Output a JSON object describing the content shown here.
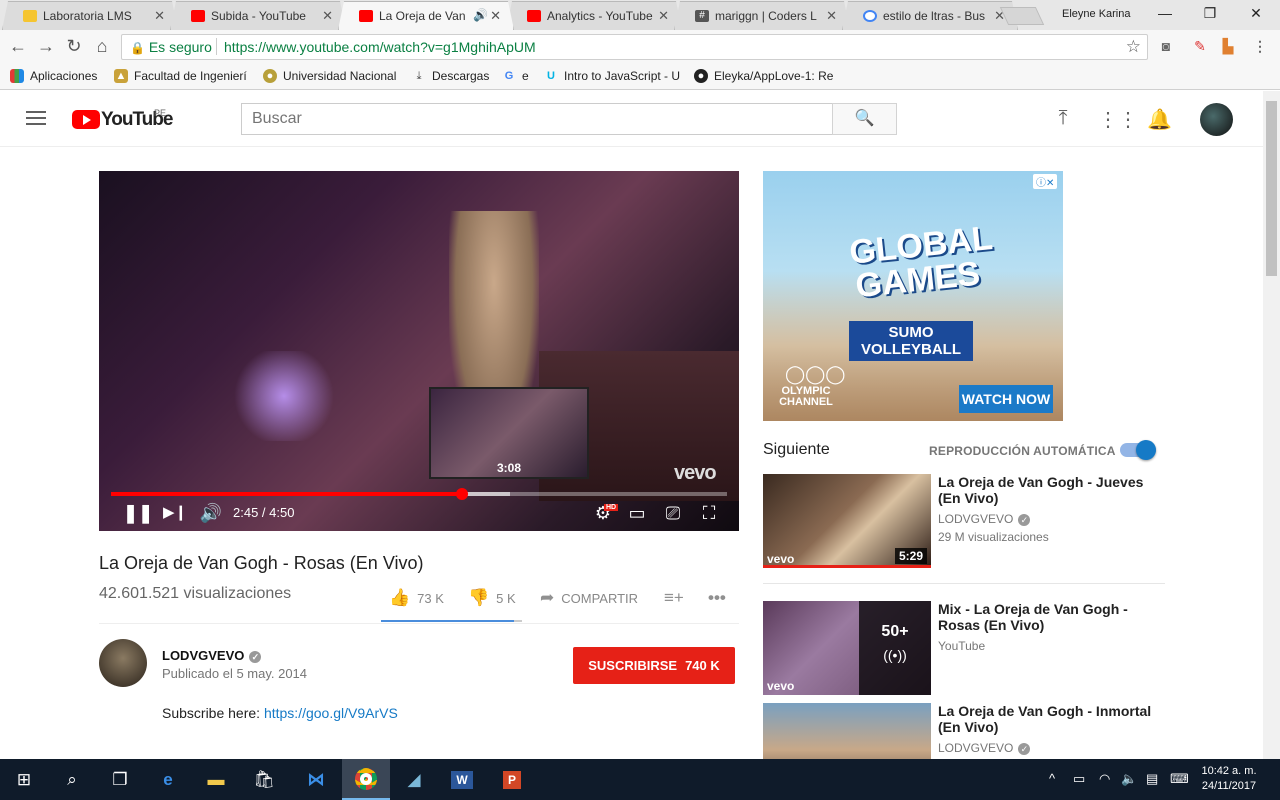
{
  "browser": {
    "tabs": [
      {
        "title": "Laboratoria LMS",
        "favicon_color": "#f5c531",
        "active": false
      },
      {
        "title": "Subida - YouTube",
        "favicon_color": "#ff0000",
        "active": false
      },
      {
        "title": "La Oreja de Van",
        "favicon_color": "#ff0000",
        "active": true,
        "audio": true
      },
      {
        "title": "Analytics - YouTube",
        "favicon_color": "#ff0000",
        "active": false
      },
      {
        "title": "mariggn | Coders L",
        "favicon_color": "#555555",
        "active": false
      },
      {
        "title": "estilo de ltras - Bus",
        "favicon_color": "#4285f4",
        "active": false
      }
    ],
    "user": "Eleyne Karina",
    "secure_label": "Es seguro",
    "url": "https://www.youtube.com/watch?v=g1MghihApUM",
    "bookmarks": [
      {
        "label": "Aplicaciones",
        "icon": "apps-grid-icon"
      },
      {
        "label": "Facultad de Ingenierí",
        "icon": "faculty-icon"
      },
      {
        "label": "Universidad Nacional",
        "icon": "university-icon"
      },
      {
        "label": "Descargas",
        "icon": "download-icon"
      },
      {
        "label": "e",
        "icon": "google-icon"
      },
      {
        "label": "Intro to JavaScript - U",
        "icon": "udacity-icon"
      },
      {
        "label": "Eleyka/AppLove-1: Re",
        "icon": "github-icon"
      }
    ]
  },
  "youtube": {
    "logo_text": "YouTube",
    "country": "PE",
    "search_placeholder": "Buscar"
  },
  "player": {
    "current_time": "2:45",
    "duration": "4:50",
    "time_display": "2:45 / 4:50",
    "preview_time": "3:08",
    "played_fraction": 0.569,
    "buffered_fraction": 0.647,
    "watermark": "vevo"
  },
  "video": {
    "title": "La Oreja de Van Gogh - Rosas (En Vivo)",
    "views": "42.601.521 visualizaciones",
    "likes": "73 K",
    "dislikes": "5 K",
    "share_label": "COMPARTIR",
    "like_fraction": 0.94,
    "channel": "LODVGVEVO",
    "published": "Publicado el 5 may. 2014",
    "subscribe_label": "SUSCRIBIRSE",
    "subscribers": "740 K",
    "description_prefix": "Subscribe here:",
    "description_link": "https://goo.gl/V9ArVS"
  },
  "ad": {
    "headline": "GLOBAL GAMES",
    "subhead": "SUMO VOLLEYBALL",
    "brand": "OLYMPIC CHANNEL",
    "cta": "WATCH NOW"
  },
  "sidebar": {
    "next_label": "Siguiente",
    "autoplay_label": "REPRODUCCIÓN AUTOMÁTICA",
    "autoplay_on": true,
    "related": [
      {
        "title": "La Oreja de Van Gogh - Jueves (En Vivo)",
        "channel": "LODVGVEVO",
        "views": "29 M visualizaciones",
        "duration": "5:29"
      },
      {
        "title": "Mix - La Oreja de Van Gogh - Rosas (En Vivo)",
        "channel": "YouTube",
        "mix_count": "50+"
      },
      {
        "title": "La Oreja de Van Gogh - Inmortal (En Vivo)",
        "channel": "LODVGVEVO"
      }
    ]
  },
  "taskbar": {
    "time": "10:42 a. m.",
    "date": "24/11/2017"
  }
}
